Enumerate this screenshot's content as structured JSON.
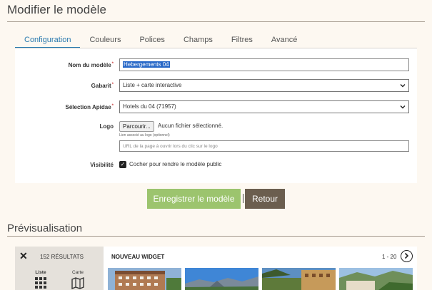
{
  "header": {
    "title": "Modifier le modèle"
  },
  "tabs": [
    {
      "label": "Configuration",
      "active": true
    },
    {
      "label": "Couleurs",
      "active": false
    },
    {
      "label": "Polices",
      "active": false
    },
    {
      "label": "Champs",
      "active": false
    },
    {
      "label": "Filtres",
      "active": false
    },
    {
      "label": "Avancé",
      "active": false
    }
  ],
  "form": {
    "name": {
      "label": "Nom du modèle",
      "required_mark": "*",
      "value": "Hebergements 04"
    },
    "gabarit": {
      "label": "Gabarit",
      "required_mark": "*",
      "value": "Liste + carte interactive"
    },
    "selection": {
      "label": "Sélection Apidae",
      "required_mark": "*",
      "value": "Hotels du 04 (71957)"
    },
    "logo": {
      "label": "Logo",
      "button": "Parcourir...",
      "status": "Aucun fichier sélectionné.",
      "link_hint": "Lien associé au logo (optionnel)",
      "link_placeholder": "URL de la page à ouvrir lors du clic sur le logo"
    },
    "visibility": {
      "label": "Visibilité",
      "checkbox_label": "Cocher pour rendre le modèle public",
      "checked": true
    }
  },
  "actions": {
    "save": "Enregistrer le modèle",
    "back": "Retour"
  },
  "preview": {
    "title": "Prévisualisation",
    "result_count": "152 RÉSULTATS",
    "view_list": "Liste",
    "view_map": "Carte",
    "widget_title": "NOUVEAU WIDGET",
    "pager": "1 - 20"
  },
  "colors": {
    "accent": "#2a7aaf",
    "save_button": "#9cc46e",
    "back_button": "#6b5e4f",
    "background": "#fdf8f1"
  }
}
